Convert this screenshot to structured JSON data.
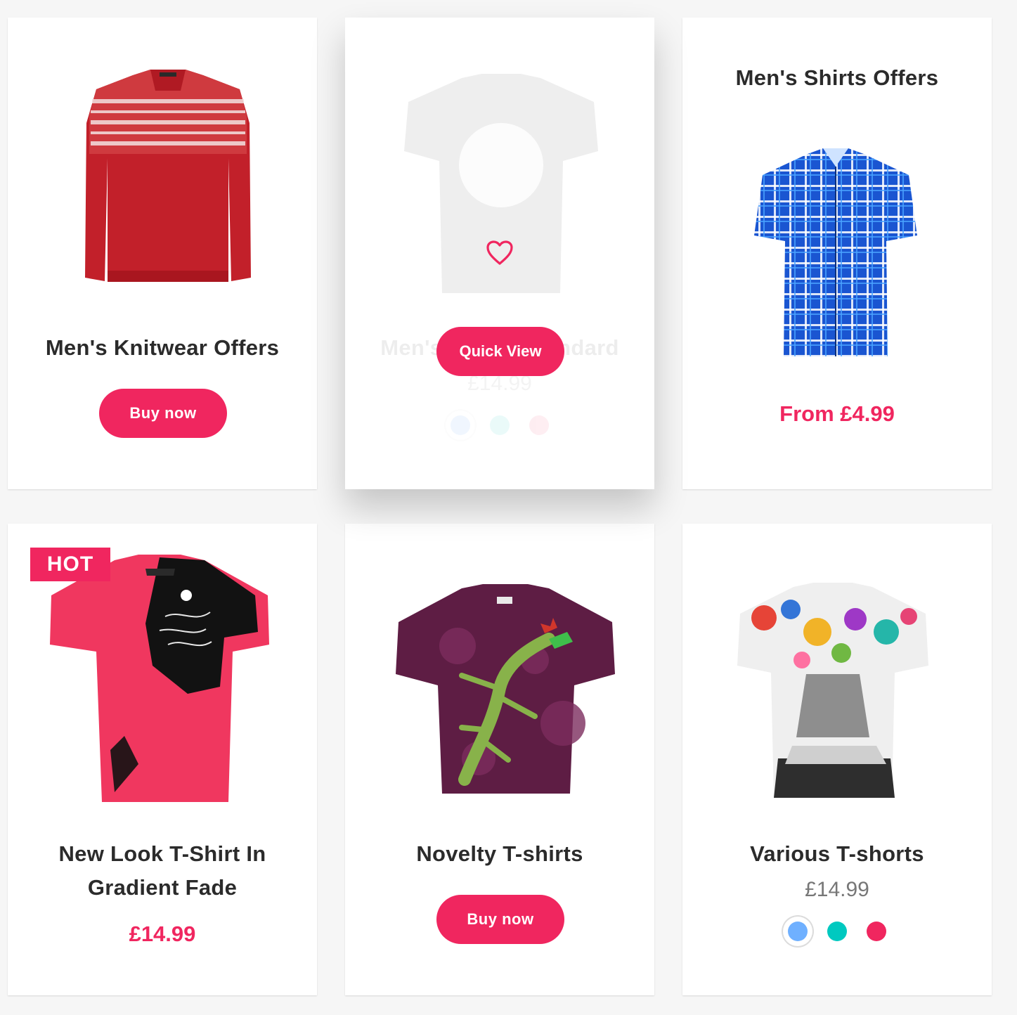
{
  "products": [
    {
      "title": "Men's Knitwear Offers",
      "button": "Buy now"
    },
    {
      "title": "Men's T-shirt Standard",
      "price": "£14.99",
      "quick_view": "Quick View",
      "swatches": [
        "#4b9bf7",
        "#06c8c2",
        "#f0265f"
      ]
    },
    {
      "title": "Men's Shirts Offers",
      "price": "From £4.99"
    },
    {
      "badge": "HOT",
      "title_line1": "New Look T-Shirt In",
      "title_line2": "Gradient Fade",
      "price": "£14.99"
    },
    {
      "title": "Novelty T-shirts",
      "button": "Buy now"
    },
    {
      "title": "Various T-shorts",
      "price": "£14.99",
      "swatches": [
        "#6fb0ff",
        "#00c9c0",
        "#f0265f"
      ]
    }
  ],
  "colors": {
    "accent": "#f0265f",
    "text": "#2b2b2b",
    "muted": "#777777",
    "background": "#f6f6f6"
  },
  "icons": {
    "wishlist": "heart-outline-icon"
  }
}
